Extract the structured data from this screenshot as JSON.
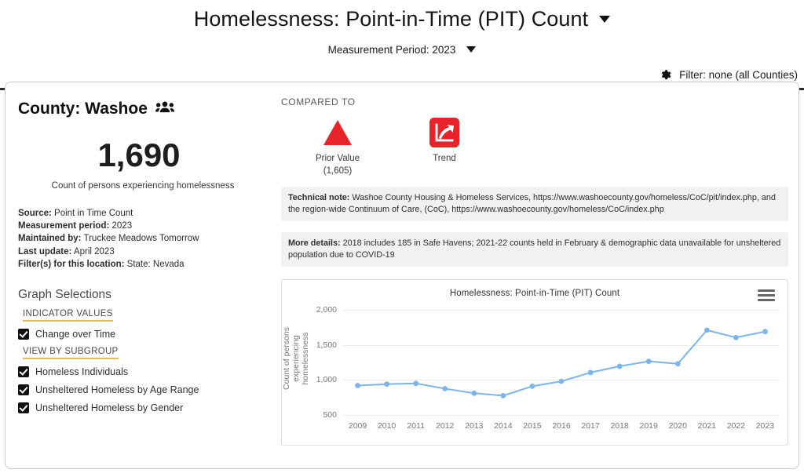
{
  "header": {
    "title": "Homelessness: Point-in-Time (PIT) Count",
    "title_caret": "chevron-down-icon",
    "measurement_period": "Measurement Period: 2023",
    "period_caret": "chevron-down-icon",
    "filter_label": "Filter: none (all Counties)",
    "filter_icon": "gear-icon"
  },
  "left_panel": {
    "county_title": "County: Washoe",
    "county_icon": "people-group-icon",
    "big_number": "1,690",
    "big_caption": "Count of persons experiencing homelessness",
    "meta": [
      {
        "key": "Source:",
        "value": " Point in Time Count"
      },
      {
        "key": "Measurement period:",
        "value": " 2023"
      },
      {
        "key": "Maintained by:",
        "value": " Truckee Meadows Tomorrow"
      },
      {
        "key": "Last update:",
        "value": " April 2023"
      },
      {
        "key": "Filter(s) for this location:",
        "value": " State: Nevada"
      }
    ],
    "graph_selections_title": "Graph Selections",
    "section_indicator_values": "INDICATOR VALUES",
    "section_view_by_subgroup": "VIEW BY SUBGROUP",
    "checks_indicator": [
      {
        "label": "Change over Time",
        "checked": true
      }
    ],
    "checks_subgroup": [
      {
        "label": "Homeless Individuals",
        "checked": true
      },
      {
        "label": "Unsheltered Homeless by Age Range",
        "checked": true
      },
      {
        "label": "Unsheltered Homeless by Gender",
        "checked": true
      }
    ],
    "accent_underline": "#e0b964"
  },
  "right_panel": {
    "compared_to": "COMPARED TO",
    "compare_items": [
      {
        "label": "Prior Value",
        "sub": "(1,605)",
        "icon": "warning-triangle-icon",
        "color": "#e8242a"
      },
      {
        "label": "Trend",
        "sub": "",
        "icon": "trend-up-icon",
        "color": "#e8242a"
      }
    ],
    "technical_note": {
      "key": "Technical note:",
      "value": " Washoe County Housing & Homeless Services, https://www.washoecounty.gov/homeless/CoC/pit/index.php, and the region-wide Continuum of Care, (CoC), https://www.washoecounty.gov/homeless/CoC/index.php"
    },
    "more_details": {
      "key": "More details:",
      "value": " 2018 includes 185 in Safe Havens; 2021-22 counts held in February & demographic data unavailable for unsheltered population due to COVID-19"
    },
    "chart_menu_icon": "hamburger-menu-icon"
  },
  "chart_data": {
    "type": "line",
    "title": "Homelessness: Point-in-Time (PIT) Count",
    "xlabel": "",
    "ylabel": "Count of persons experiencing homelessness",
    "ylabel_lines": [
      "Count of persons experiencing",
      "homelessness"
    ],
    "categories": [
      "2009",
      "2010",
      "2011",
      "2012",
      "2013",
      "2014",
      "2015",
      "2016",
      "2017",
      "2018",
      "2019",
      "2020",
      "2021",
      "2022",
      "2023"
    ],
    "series": [
      {
        "name": "Count of persons experiencing homelessness",
        "color": "#7cb5ec",
        "values": [
          920,
          940,
          950,
          875,
          810,
          775,
          910,
          980,
          1105,
          1195,
          1265,
          1230,
          1710,
          1605,
          1690
        ]
      }
    ],
    "yticks": [
      500,
      1000,
      1500,
      2000
    ],
    "yticklabels": [
      "500",
      "1,000",
      "1,500",
      "2,000"
    ],
    "ylim": [
      500,
      2000
    ],
    "grid": true,
    "legend": false
  }
}
